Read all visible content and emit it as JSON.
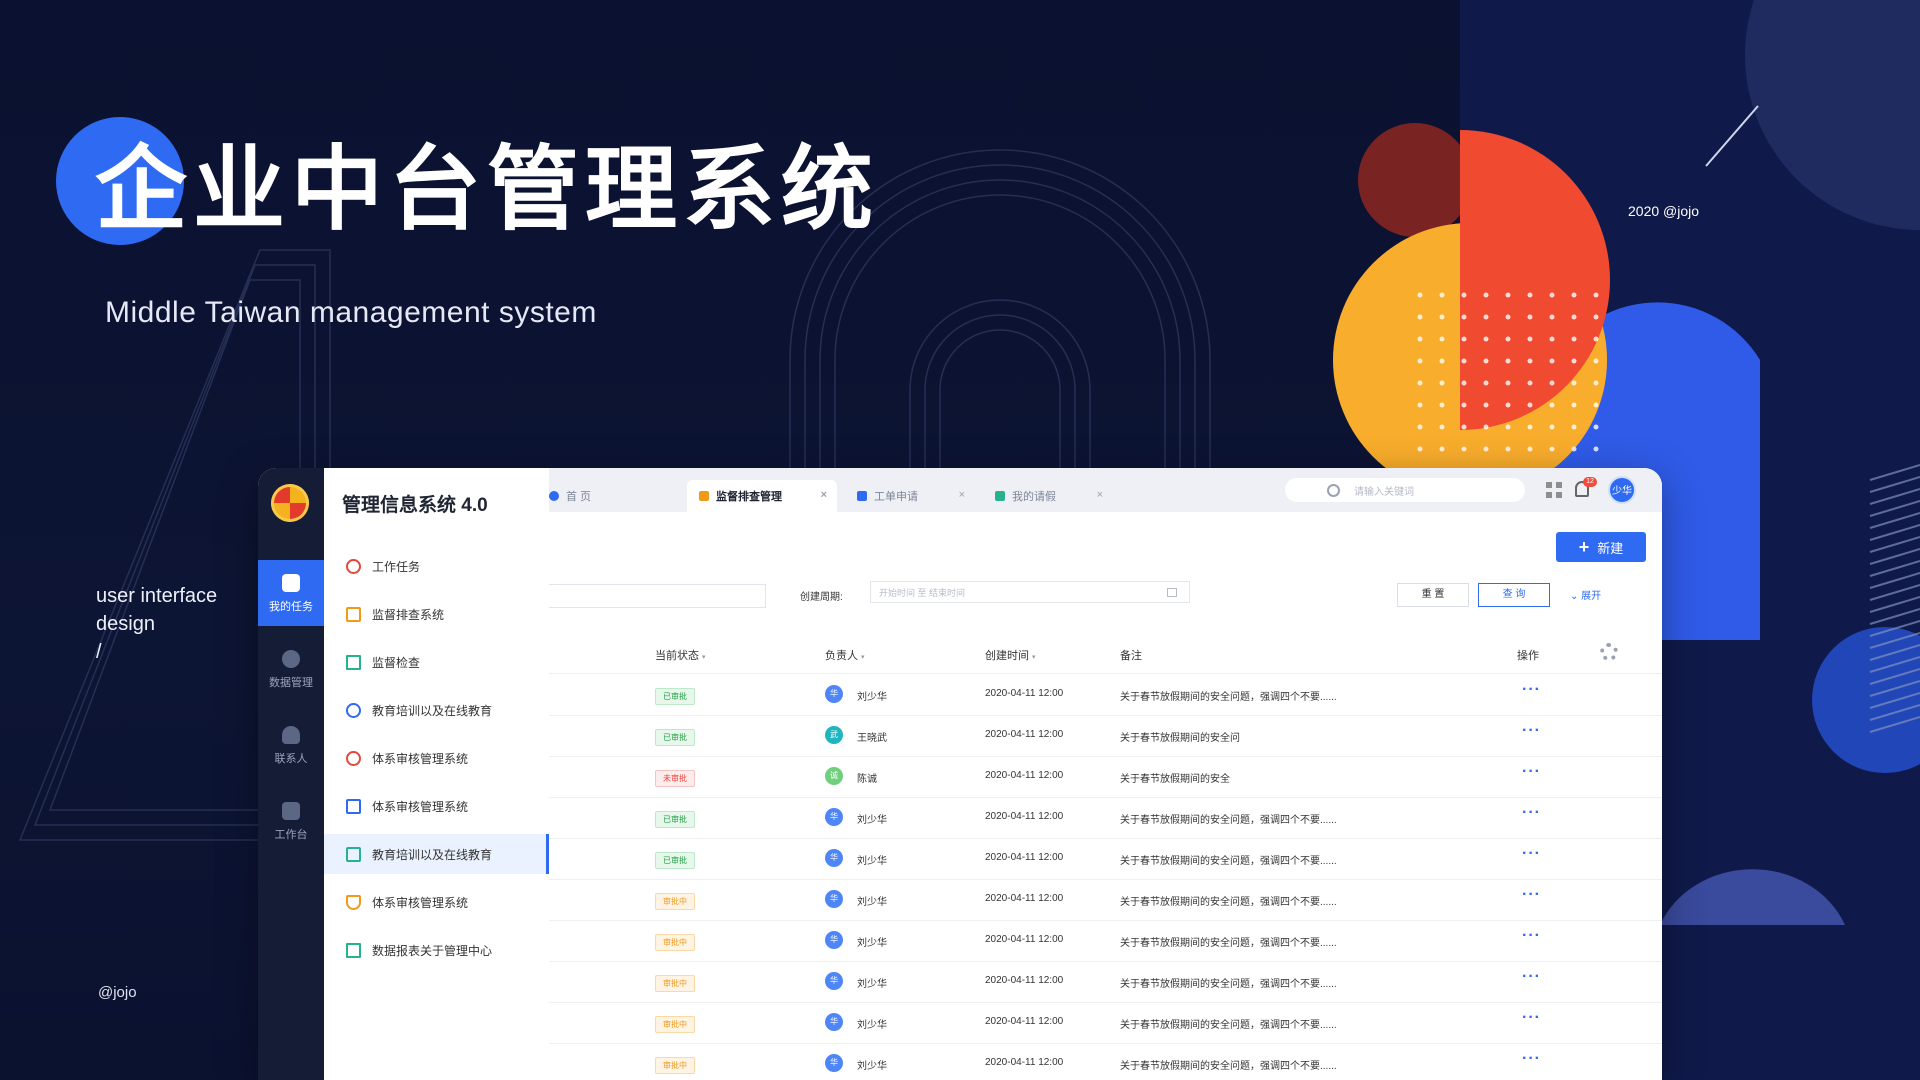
{
  "hero": {
    "title": "企业中台管理系统",
    "subtitle": "Middle Taiwan management system",
    "ui_line1": "user interface",
    "ui_line2": "design",
    "ui_line3": "/",
    "handle": "@jojo",
    "year_credit": "2020 @jojo"
  },
  "colors": {
    "accent": "#2f6bf2",
    "bg": "#0b1230",
    "orange": "#f9ad2c",
    "red": "#f04a30"
  },
  "rail": {
    "items": [
      {
        "label": "我的任务",
        "icon": "task-icon",
        "active": true
      },
      {
        "label": "数据管理",
        "icon": "pie-chart-icon",
        "active": false
      },
      {
        "label": "联系人",
        "icon": "contact-icon",
        "active": false
      },
      {
        "label": "工作台",
        "icon": "workbench-icon",
        "active": false
      }
    ]
  },
  "menu": {
    "title": "管理信息系统 4.0",
    "items": [
      {
        "label": "工作任务",
        "icon": "alert-circle-icon",
        "color": "#e8443a"
      },
      {
        "label": "监督排查系统",
        "icon": "monitor-icon",
        "color": "#f19a1a"
      },
      {
        "label": "监督检查",
        "icon": "bar-chart-icon",
        "color": "#27b28d"
      },
      {
        "label": "教育培训以及在线教育",
        "icon": "refresh-icon",
        "color": "#2f6bf2"
      },
      {
        "label": "体系审核管理系统",
        "icon": "alert-circle-icon",
        "color": "#e8443a"
      },
      {
        "label": "体系审核管理系统",
        "icon": "briefcase-icon",
        "color": "#2f6bf2"
      },
      {
        "label": "教育培训以及在线教育",
        "icon": "form-icon",
        "color": "#27b28d"
      },
      {
        "label": "体系审核管理系统",
        "icon": "shield-icon",
        "color": "#f19a1a"
      },
      {
        "label": "数据报表关于管理中心",
        "icon": "bar-chart-icon",
        "color": "#27b28d"
      }
    ]
  },
  "tabs": [
    {
      "label": "首 页",
      "icon": "refresh-icon",
      "closable": false,
      "active": false
    },
    {
      "label": "监督排查管理",
      "icon": "monitor-icon",
      "closable": true,
      "active": true
    },
    {
      "label": "工单申请",
      "icon": "home-icon",
      "closable": true,
      "active": false
    },
    {
      "label": "我的请假",
      "icon": "bar-chart-icon",
      "closable": true,
      "active": false
    }
  ],
  "topbar": {
    "search_placeholder": "请输入关键词",
    "notification_count": "12",
    "user_initials": "少华",
    "close_glyph": "×"
  },
  "toolbar": {
    "new_label": "新建",
    "plus_glyph": "+"
  },
  "filters": {
    "period_label": "创建周期:",
    "date_placeholder": "开始时间 至 结束时间",
    "reset_label": "重 置",
    "query_label": "查 询",
    "expand_label": "展开",
    "expand_glyph": "⌄"
  },
  "table": {
    "headers": {
      "status": "当前状态",
      "owner": "负责人",
      "created": "创建时间",
      "note": "备注",
      "action": "操作",
      "sort_glyph": "▾"
    },
    "more_glyph": "···",
    "rows": [
      {
        "status": "已审批",
        "status_type": "ok",
        "avatar": "华",
        "avatar_color": "#4f86f7",
        "owner": "刘少华",
        "time": "2020-04-11  12:00",
        "note": "关于春节放假期间的安全问题，强调四个不要......"
      },
      {
        "status": "已审批",
        "status_type": "ok",
        "avatar": "武",
        "avatar_color": "#1fb6c1",
        "owner": "王晓武",
        "time": "2020-04-11  12:00",
        "note": "关于春节放假期间的安全问"
      },
      {
        "status": "未审批",
        "status_type": "no",
        "avatar": "诚",
        "avatar_color": "#6fcf7c",
        "owner": "陈诚",
        "time": "2020-04-11  12:00",
        "note": "关于春节放假期间的安全"
      },
      {
        "status": "已审批",
        "status_type": "ok",
        "avatar": "华",
        "avatar_color": "#4f86f7",
        "owner": "刘少华",
        "time": "2020-04-11  12:00",
        "note": "关于春节放假期间的安全问题，强调四个不要......"
      },
      {
        "status": "已审批",
        "status_type": "ok",
        "avatar": "华",
        "avatar_color": "#4f86f7",
        "owner": "刘少华",
        "time": "2020-04-11  12:00",
        "note": "关于春节放假期间的安全问题，强调四个不要......"
      },
      {
        "status": "审批中",
        "status_type": "ing",
        "avatar": "华",
        "avatar_color": "#4f86f7",
        "owner": "刘少华",
        "time": "2020-04-11  12:00",
        "note": "关于春节放假期间的安全问题，强调四个不要......"
      },
      {
        "status": "审批中",
        "status_type": "ing",
        "avatar": "华",
        "avatar_color": "#4f86f7",
        "owner": "刘少华",
        "time": "2020-04-11  12:00",
        "note": "关于春节放假期间的安全问题，强调四个不要......"
      },
      {
        "status": "审批中",
        "status_type": "ing",
        "avatar": "华",
        "avatar_color": "#4f86f7",
        "owner": "刘少华",
        "time": "2020-04-11  12:00",
        "note": "关于春节放假期间的安全问题，强调四个不要......"
      },
      {
        "status": "审批中",
        "status_type": "ing",
        "avatar": "华",
        "avatar_color": "#4f86f7",
        "owner": "刘少华",
        "time": "2020-04-11  12:00",
        "note": "关于春节放假期间的安全问题，强调四个不要......"
      },
      {
        "status": "审批中",
        "status_type": "ing",
        "avatar": "华",
        "avatar_color": "#4f86f7",
        "owner": "刘少华",
        "time": "2020-04-11  12:00",
        "note": "关于春节放假期间的安全问题，强调四个不要......"
      }
    ]
  }
}
